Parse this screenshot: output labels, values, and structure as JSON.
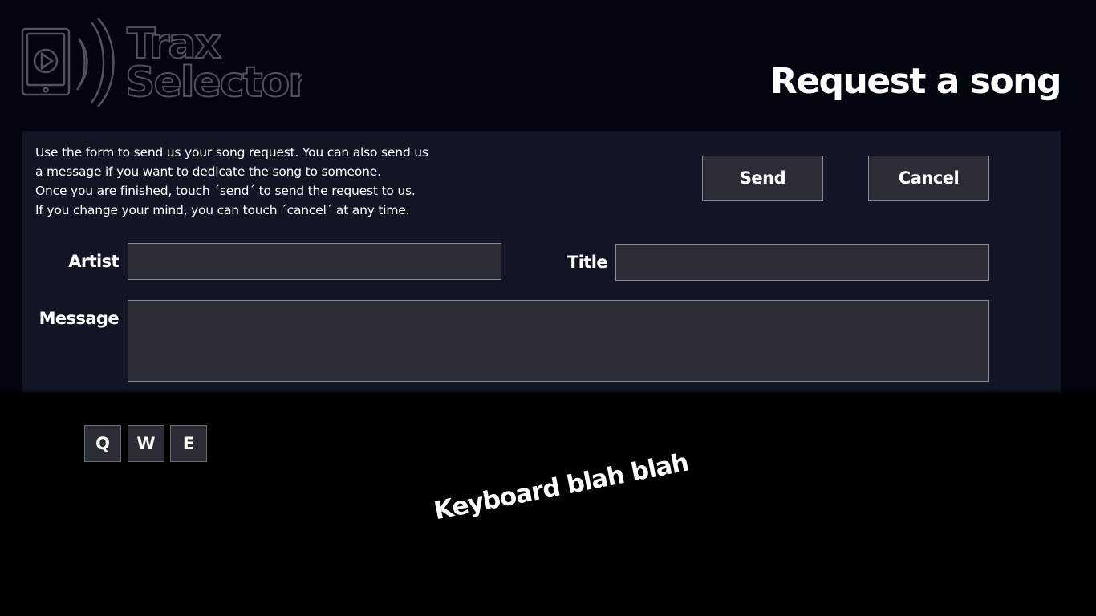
{
  "logo": {
    "line1": "Trax",
    "line2": "Selector",
    "icon": "tablet-play-broadcast-icon"
  },
  "header": {
    "title": "Request a song"
  },
  "form": {
    "instructions": [
      "Use the form to send us your song request. You can also send us",
      "a message if you want to dedicate the song to someone.",
      "Once you are finished, touch ´send´ to send the request to us.",
      "If you change your mind, you can touch ´cancel´ at any time."
    ],
    "send_label": "Send",
    "cancel_label": "Cancel",
    "artist_label": "Artist",
    "artist_value": "",
    "title_label": "Title",
    "title_value": "",
    "message_label": "Message",
    "message_value": ""
  },
  "keyboard": {
    "keys": [
      "Q",
      "W",
      "E"
    ],
    "note": "Keyboard blah blah"
  },
  "colors": {
    "background_top": "#02040f",
    "panel": "#121624",
    "field": "#2a2d36",
    "border": "#8a8c92",
    "logo_stroke": "#50535b",
    "keyboard_bg": "#000000"
  }
}
